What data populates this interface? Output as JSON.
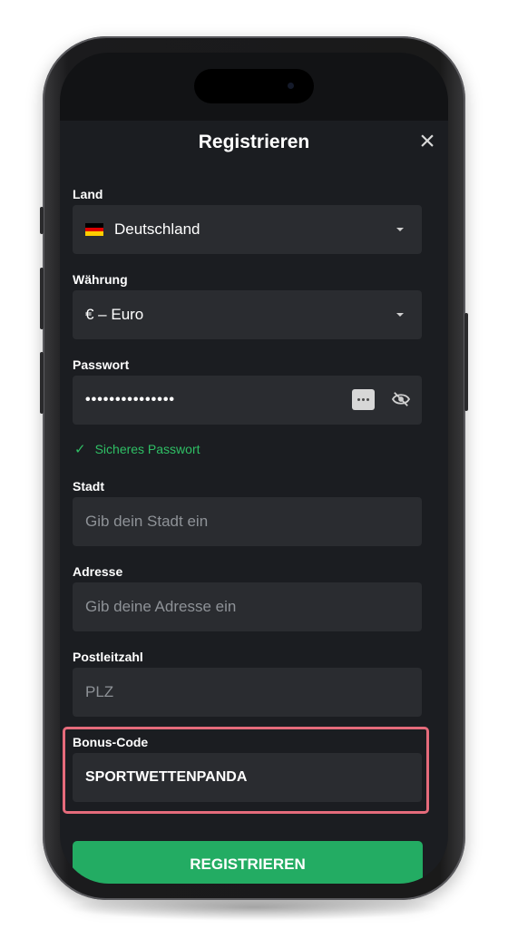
{
  "header": {
    "title": "Registrieren",
    "close_icon": "close-icon"
  },
  "form": {
    "country": {
      "label": "Land",
      "value": "Deutschland",
      "flag_icon": "germany-flag-icon"
    },
    "currency": {
      "label": "Währung",
      "value": "€ – Euro"
    },
    "password": {
      "label": "Passwort",
      "value": "•••••••••••••••",
      "strength_text": "Sicheres Passwort",
      "strength_color": "#2fbf65"
    },
    "city": {
      "label": "Stadt",
      "placeholder": "Gib dein Stadt ein"
    },
    "address": {
      "label": "Adresse",
      "placeholder": "Gib deine Adresse ein"
    },
    "zip": {
      "label": "Postleitzahl",
      "placeholder": "PLZ"
    },
    "bonus": {
      "label": "Bonus-Code",
      "value": "SPORTWETTENPANDA",
      "highlight_color": "#e56b7b"
    }
  },
  "register_button": {
    "label": "REGISTRIEREN",
    "color": "#23ac63"
  }
}
